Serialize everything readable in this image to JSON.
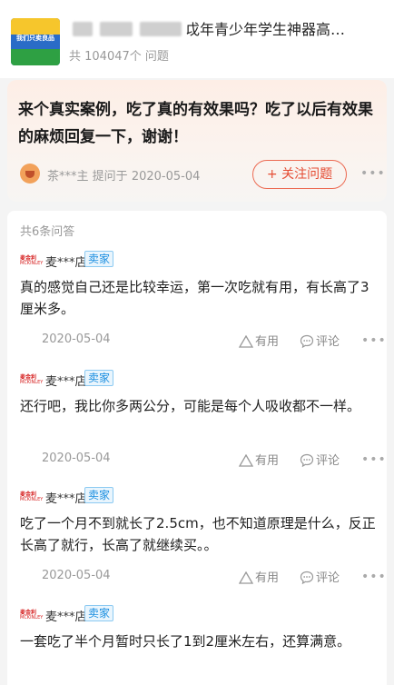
{
  "header": {
    "product_title": "戉年青少年学生神器高…",
    "question_count": "共 104047个 问题",
    "thumb_text": "我们只卖良品"
  },
  "question": {
    "text": "来个真实案例，吃了真的有效果吗？吃了以后有效果的麻烦回复一下，谢谢！",
    "asker": "茶***主",
    "asked_label": "提问于",
    "date": "2020-05-04",
    "follow_label": "+ 关注问题",
    "more": "•••"
  },
  "answers_header": "共6条问答",
  "answers": [
    {
      "logo_top": "麦金利",
      "logo_bottom": "MCKINLEY",
      "seller": "麦***店",
      "tag": "卖家",
      "text": "真的感觉自己还是比较幸运，第一次吃就有用，有长高了3厘米多。",
      "date": "2020-05-04",
      "useful": "有用",
      "comment": "评论",
      "more": "•••"
    },
    {
      "logo_top": "麦金利",
      "logo_bottom": "MCKINLEY",
      "seller": "麦***店",
      "tag": "卖家",
      "text": "还行吧，我比你多两公分，可能是每个人吸收都不一样。",
      "date": "2020-05-04",
      "useful": "有用",
      "comment": "评论",
      "more": "•••"
    },
    {
      "logo_top": "麦金利",
      "logo_bottom": "MCKINLEY",
      "seller": "麦***店",
      "tag": "卖家",
      "text": "吃了一个月不到就长了2.5cm，也不知道原理是什么，反正长高了就行，长高了就继续买。。",
      "date": "2020-05-04",
      "useful": "有用",
      "comment": "评论",
      "more": "•••"
    },
    {
      "logo_top": "麦金利",
      "logo_bottom": "MCKINLEY",
      "seller": "麦***店",
      "tag": "卖家",
      "text": "一套吃了半个月暂时只长了1到2厘米左右，还算满意。",
      "date": "",
      "useful": "",
      "comment": "",
      "more": ""
    }
  ],
  "colors": {
    "accent_red": "#e54c33",
    "seller_tag_blue": "#1a8ee0",
    "muted_text": "#999999"
  }
}
